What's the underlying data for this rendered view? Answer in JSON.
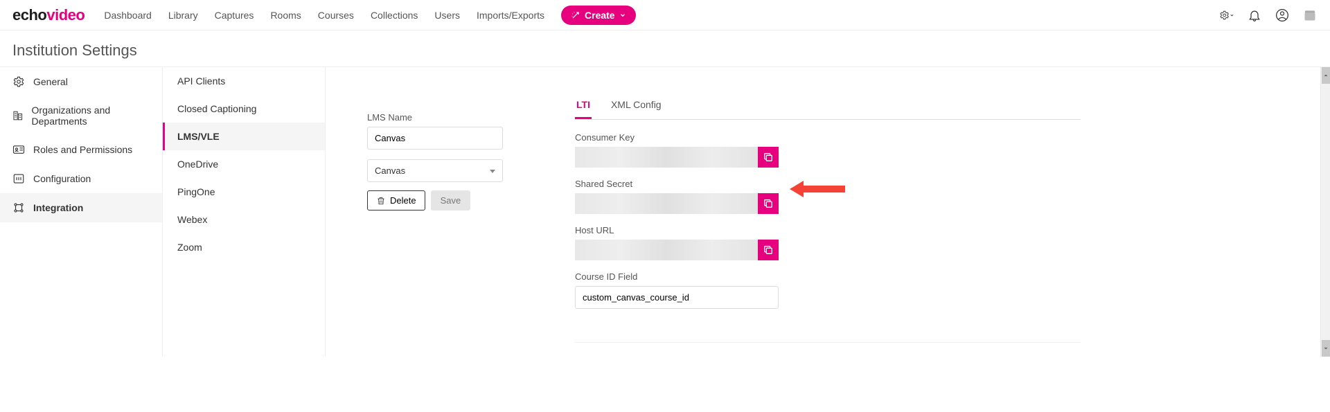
{
  "logo": {
    "part1": "echo",
    "part2": "video"
  },
  "nav": [
    "Dashboard",
    "Library",
    "Captures",
    "Rooms",
    "Courses",
    "Collections",
    "Users",
    "Imports/Exports"
  ],
  "create_label": "Create",
  "page_title": "Institution Settings",
  "sidebar1": [
    {
      "label": "General"
    },
    {
      "label": "Organizations and Departments"
    },
    {
      "label": "Roles and Permissions"
    },
    {
      "label": "Configuration"
    },
    {
      "label": "Integration"
    }
  ],
  "sidebar2": [
    "API Clients",
    "Closed Captioning",
    "LMS/VLE",
    "OneDrive",
    "PingOne",
    "Webex",
    "Zoom"
  ],
  "form": {
    "lms_name_label": "LMS Name",
    "lms_name_value": "Canvas",
    "lms_select_value": "Canvas",
    "delete_label": "Delete",
    "save_label": "Save"
  },
  "tabs": [
    "LTI",
    "XML Config"
  ],
  "lti": {
    "consumer_key_label": "Consumer Key",
    "shared_secret_label": "Shared Secret",
    "host_url_label": "Host URL",
    "course_id_label": "Course ID Field",
    "course_id_value": "custom_canvas_course_id"
  }
}
